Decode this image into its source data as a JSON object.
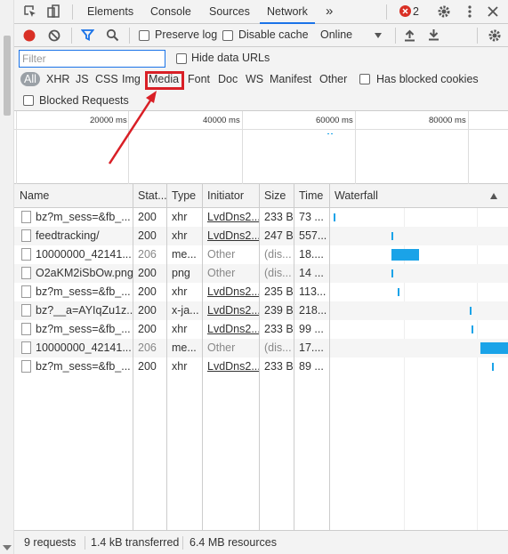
{
  "tabs": {
    "elements": "Elements",
    "console": "Console",
    "sources": "Sources",
    "network": "Network",
    "more": "»",
    "error_count": "2"
  },
  "toolbar": {
    "preserve_log": "Preserve log",
    "disable_cache": "Disable cache",
    "throttling": "Online"
  },
  "filter": {
    "placeholder": "Filter",
    "hide_data_urls": "Hide data URLs",
    "types": [
      "All",
      "XHR",
      "JS",
      "CSS",
      "Img",
      "Media",
      "Font",
      "Doc",
      "WS",
      "Manifest",
      "Other"
    ],
    "has_blocked_cookies": "Has blocked cookies",
    "blocked_requests": "Blocked Requests"
  },
  "overview": {
    "ticks": [
      "20000 ms",
      "40000 ms",
      "60000 ms",
      "80000 ms"
    ]
  },
  "table": {
    "headers": [
      "Name",
      "Stat...",
      "Type",
      "Initiator",
      "Size",
      "Time",
      "Waterfall"
    ],
    "rows": [
      [
        "bz?m_sess=&fb_...",
        "200",
        "xhr",
        "LvdDns2...",
        "233 B",
        "73 ..."
      ],
      [
        "feedtracking/",
        "200",
        "xhr",
        "LvdDns2...",
        "247 B",
        "557..."
      ],
      [
        "10000000_42141...",
        "206",
        "me...",
        "Other",
        "(dis...",
        "18...."
      ],
      [
        "O2aKM2iSbOw.png",
        "200",
        "png",
        "Other",
        "(dis...",
        "14 ..."
      ],
      [
        "bz?m_sess=&fb_...",
        "200",
        "xhr",
        "LvdDns2...",
        "235 B",
        "113..."
      ],
      [
        "bz?__a=AYIqZu1z...",
        "200",
        "x-ja...",
        "LvdDns2...",
        "239 B",
        "218..."
      ],
      [
        "bz?m_sess=&fb_...",
        "200",
        "xhr",
        "LvdDns2...",
        "233 B",
        "99 ..."
      ],
      [
        "10000000_42141...",
        "206",
        "me...",
        "Other",
        "(dis...",
        "17...."
      ],
      [
        "bz?m_sess=&fb_...",
        "200",
        "xhr",
        "LvdDns2...",
        "233 B",
        "89 ..."
      ]
    ]
  },
  "status": {
    "requests": "9 requests",
    "transferred": "1.4 kB transferred",
    "resources": "6.4 MB resources"
  },
  "colors": {
    "accent": "#1a73e8",
    "record": "#d93025",
    "highlight": "#d91f26",
    "waterfall": "#1aa3e8"
  }
}
